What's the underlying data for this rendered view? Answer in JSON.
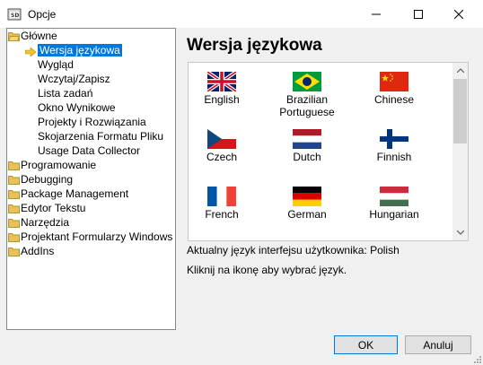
{
  "window": {
    "title": "Opcje"
  },
  "tree": {
    "root": {
      "label": "Główne"
    },
    "children": [
      {
        "label": "Wersja językowa",
        "selected": true
      },
      {
        "label": "Wygląd"
      },
      {
        "label": "Wczytaj/Zapisz"
      },
      {
        "label": "Lista zadań"
      },
      {
        "label": "Okno Wynikowe"
      },
      {
        "label": "Projekty i Rozwiązania"
      },
      {
        "label": "Skojarzenia Formatu Pliku"
      },
      {
        "label": "Usage Data Collector"
      }
    ],
    "folders": [
      {
        "label": "Programowanie"
      },
      {
        "label": "Debugging"
      },
      {
        "label": "Package Management"
      },
      {
        "label": "Edytor Tekstu"
      },
      {
        "label": "Narzędzia"
      },
      {
        "label": "Projektant Formularzy Windows"
      },
      {
        "label": "AddIns"
      }
    ]
  },
  "panel": {
    "heading": "Wersja językowa",
    "languages": [
      {
        "name": "English",
        "flag": "uk-flag-icon"
      },
      {
        "name": "Brazilian Portuguese",
        "flag": "brazil-flag-icon"
      },
      {
        "name": "Chinese",
        "flag": "china-flag-icon"
      },
      {
        "name": "Czech",
        "flag": "czech-flag-icon"
      },
      {
        "name": "Dutch",
        "flag": "netherlands-flag-icon"
      },
      {
        "name": "Finnish",
        "flag": "finland-flag-icon"
      },
      {
        "name": "French",
        "flag": "france-flag-icon"
      },
      {
        "name": "German",
        "flag": "germany-flag-icon"
      },
      {
        "name": "Hungarian",
        "flag": "hungary-flag-icon"
      }
    ],
    "current_language": "Aktualny język interfejsu użytkownika: Polish",
    "hint": "Kliknij na ikonę aby wybrać język."
  },
  "buttons": {
    "ok": "OK",
    "cancel": "Anuluj"
  },
  "colors": {
    "selection": "#0078d7",
    "folder": "#e8c15a"
  }
}
